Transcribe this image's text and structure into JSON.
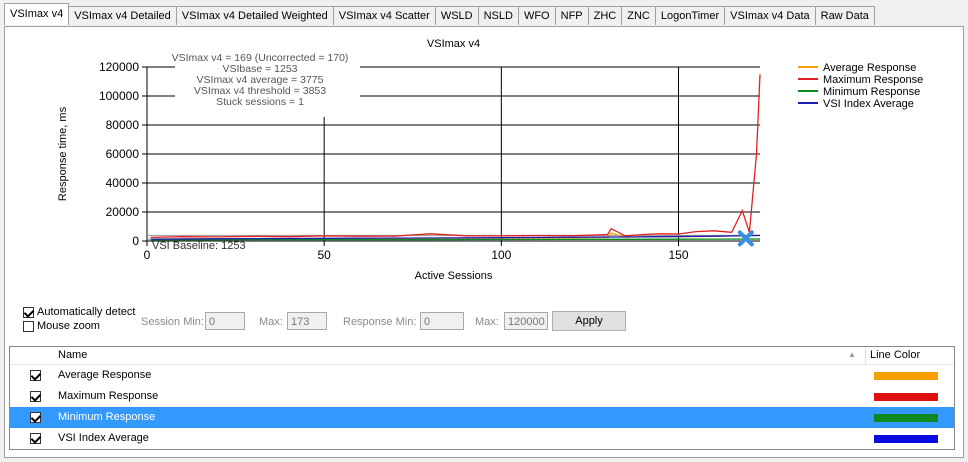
{
  "tabs": [
    {
      "label": "VSImax v4",
      "active": true
    },
    {
      "label": "VSImax v4 Detailed"
    },
    {
      "label": "VSImax v4 Detailed Weighted"
    },
    {
      "label": "VSImax v4 Scatter"
    },
    {
      "label": "WSLD"
    },
    {
      "label": "NSLD"
    },
    {
      "label": "WFO"
    },
    {
      "label": "NFP"
    },
    {
      "label": "ZHC"
    },
    {
      "label": "ZNC"
    },
    {
      "label": "LogonTimer"
    },
    {
      "label": "VSImax v4 Data"
    },
    {
      "label": "Raw Data"
    }
  ],
  "chart_data": {
    "type": "line",
    "title": "VSImax v4",
    "xlabel": "Active Sessions",
    "ylabel": "Response time, ms",
    "xlim": [
      0,
      173
    ],
    "ylim": [
      0,
      120000
    ],
    "x_ticks": [
      0,
      50,
      100,
      150
    ],
    "y_ticks": [
      0,
      20000,
      40000,
      60000,
      80000,
      100000,
      120000
    ],
    "y_tick_labels": [
      "0",
      "20000",
      "40000",
      "60000",
      "80000",
      "100000",
      "120000"
    ],
    "x_tick_labels": [
      "0",
      "50",
      "100",
      "150"
    ],
    "grid": true,
    "legend_position": "right",
    "annotation_lines": [
      "VSImax v4 = 169 (Uncorrected = 170)",
      "VSIbase = 1253",
      "VSImax v4 average = 3775",
      "VSImax v4 threshold = 3853",
      "Stuck sessions = 1"
    ],
    "baseline_label": "VSI Baseline: 1253",
    "baseline_value": 1253,
    "threshold_value": 3853,
    "vsimax_marker": {
      "x": 169,
      "y": 3853
    },
    "series": [
      {
        "name": "Average Response",
        "color": "#f5a000",
        "x": [
          1,
          20,
          40,
          60,
          80,
          100,
          120,
          130,
          131,
          135,
          140,
          150,
          160,
          165,
          170,
          173
        ],
        "y": [
          1300,
          1500,
          1600,
          1800,
          1900,
          2100,
          2300,
          2500,
          5500,
          2600,
          2800,
          3000,
          3200,
          3500,
          3800,
          4000
        ]
      },
      {
        "name": "Maximum Response",
        "color": "#e02020",
        "x": [
          1,
          10,
          20,
          30,
          40,
          50,
          60,
          70,
          80,
          90,
          100,
          110,
          120,
          125,
          130,
          131,
          135,
          140,
          145,
          150,
          155,
          160,
          165,
          168,
          170,
          172,
          173
        ],
        "y": [
          2500,
          3000,
          2800,
          3200,
          3000,
          3500,
          3300,
          3400,
          5000,
          3600,
          3500,
          3800,
          3700,
          4000,
          4500,
          8500,
          3500,
          4500,
          5000,
          4800,
          6500,
          7000,
          6000,
          21000,
          6000,
          60000,
          115000
        ]
      },
      {
        "name": "Minimum Response",
        "color": "#0a8a1a",
        "x": [
          1,
          20,
          40,
          60,
          80,
          100,
          120,
          130,
          140,
          150,
          160,
          170,
          173
        ],
        "y": [
          900,
          900,
          950,
          1000,
          1000,
          1050,
          1100,
          1200,
          1200,
          1250,
          1300,
          1350,
          1400
        ]
      },
      {
        "name": "VSI Index Average",
        "color": "#1c1cb0",
        "x": [
          1,
          20,
          40,
          60,
          80,
          100,
          120,
          140,
          160,
          170,
          173
        ],
        "y": [
          1300,
          1500,
          1700,
          1900,
          2100,
          2300,
          2600,
          2900,
          3300,
          3700,
          3800
        ]
      }
    ]
  },
  "controls": {
    "auto_detect_label": "Automatically detect",
    "auto_detect_checked": true,
    "mouse_zoom_label": "Mouse zoom",
    "mouse_zoom_checked": false,
    "session_min_label": "Session Min:",
    "session_min_value": "0",
    "session_max_label": "Max:",
    "session_max_value": "173",
    "response_min_label": "Response Min:",
    "response_min_value": "0",
    "response_max_label": "Max:",
    "response_max_value": "120000",
    "apply_label": "Apply"
  },
  "grid": {
    "col_name": "Name",
    "col_color": "Line Color",
    "sort_icon": "sort-up-icon",
    "rows": [
      {
        "name": "Average Response",
        "checked": true,
        "color": "#f5a000",
        "selected": false
      },
      {
        "name": "Maximum Response",
        "checked": true,
        "color": "#e01010",
        "selected": false
      },
      {
        "name": "Minimum Response",
        "checked": true,
        "color": "#108a20",
        "selected": true
      },
      {
        "name": "VSI Index Average",
        "checked": true,
        "color": "#0a0ae0",
        "selected": false
      }
    ]
  },
  "colors": {
    "selection": "#3399ff"
  }
}
